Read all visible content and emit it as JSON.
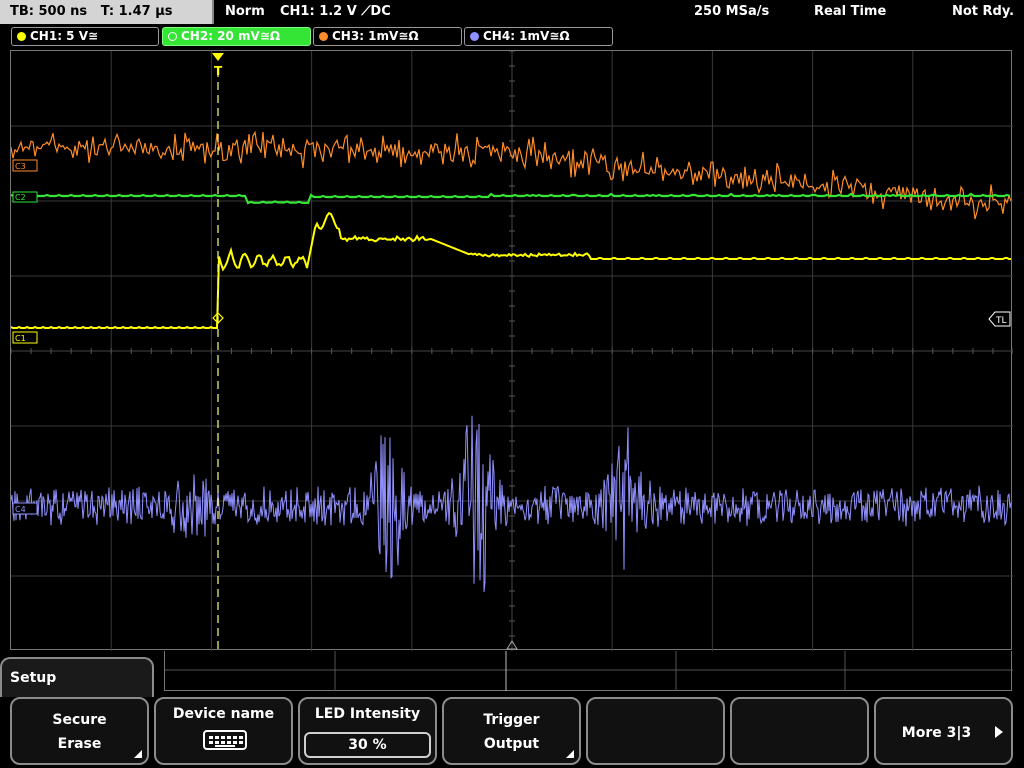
{
  "status_bar": {
    "timebase": "TB: 500 ns   T: 1.47 µs",
    "mode": "Norm",
    "trigger": "CH1: 1.2 V ⟋DC",
    "sample_rate": "250 MSa/s",
    "acquisition": "Real Time",
    "state": "Not Rdy."
  },
  "channels": [
    {
      "label": "CH1: 5 V≅",
      "color": "#ffff00",
      "active": false
    },
    {
      "label": "CH2: 20 mV≅Ω",
      "color": "#35e535",
      "active": true
    },
    {
      "label": "CH3: 1mV≅Ω",
      "color": "#ff8c2a",
      "active": false
    },
    {
      "label": "CH4: 1mV≅Ω",
      "color": "#9090ff",
      "active": false
    }
  ],
  "markers": {
    "trigger": "T",
    "trigger_level": "TL",
    "ch1": "C1",
    "ch2": "C2",
    "ch3": "C3",
    "ch4": "C4"
  },
  "menu": {
    "title": "Setup",
    "softkeys": [
      {
        "line1": "Secure",
        "line2": "Erase",
        "has_submenu": true
      },
      {
        "line1": "Device name",
        "icon": "keyboard-icon"
      },
      {
        "line1": "LED Intensity",
        "value": "30 %"
      },
      {
        "line1": "Trigger",
        "line2": "Output",
        "has_submenu": true
      },
      {
        "line1": ""
      },
      {
        "line1": ""
      },
      {
        "line1": "More 3|3",
        "icon": "arrow-right-icon"
      }
    ]
  }
}
